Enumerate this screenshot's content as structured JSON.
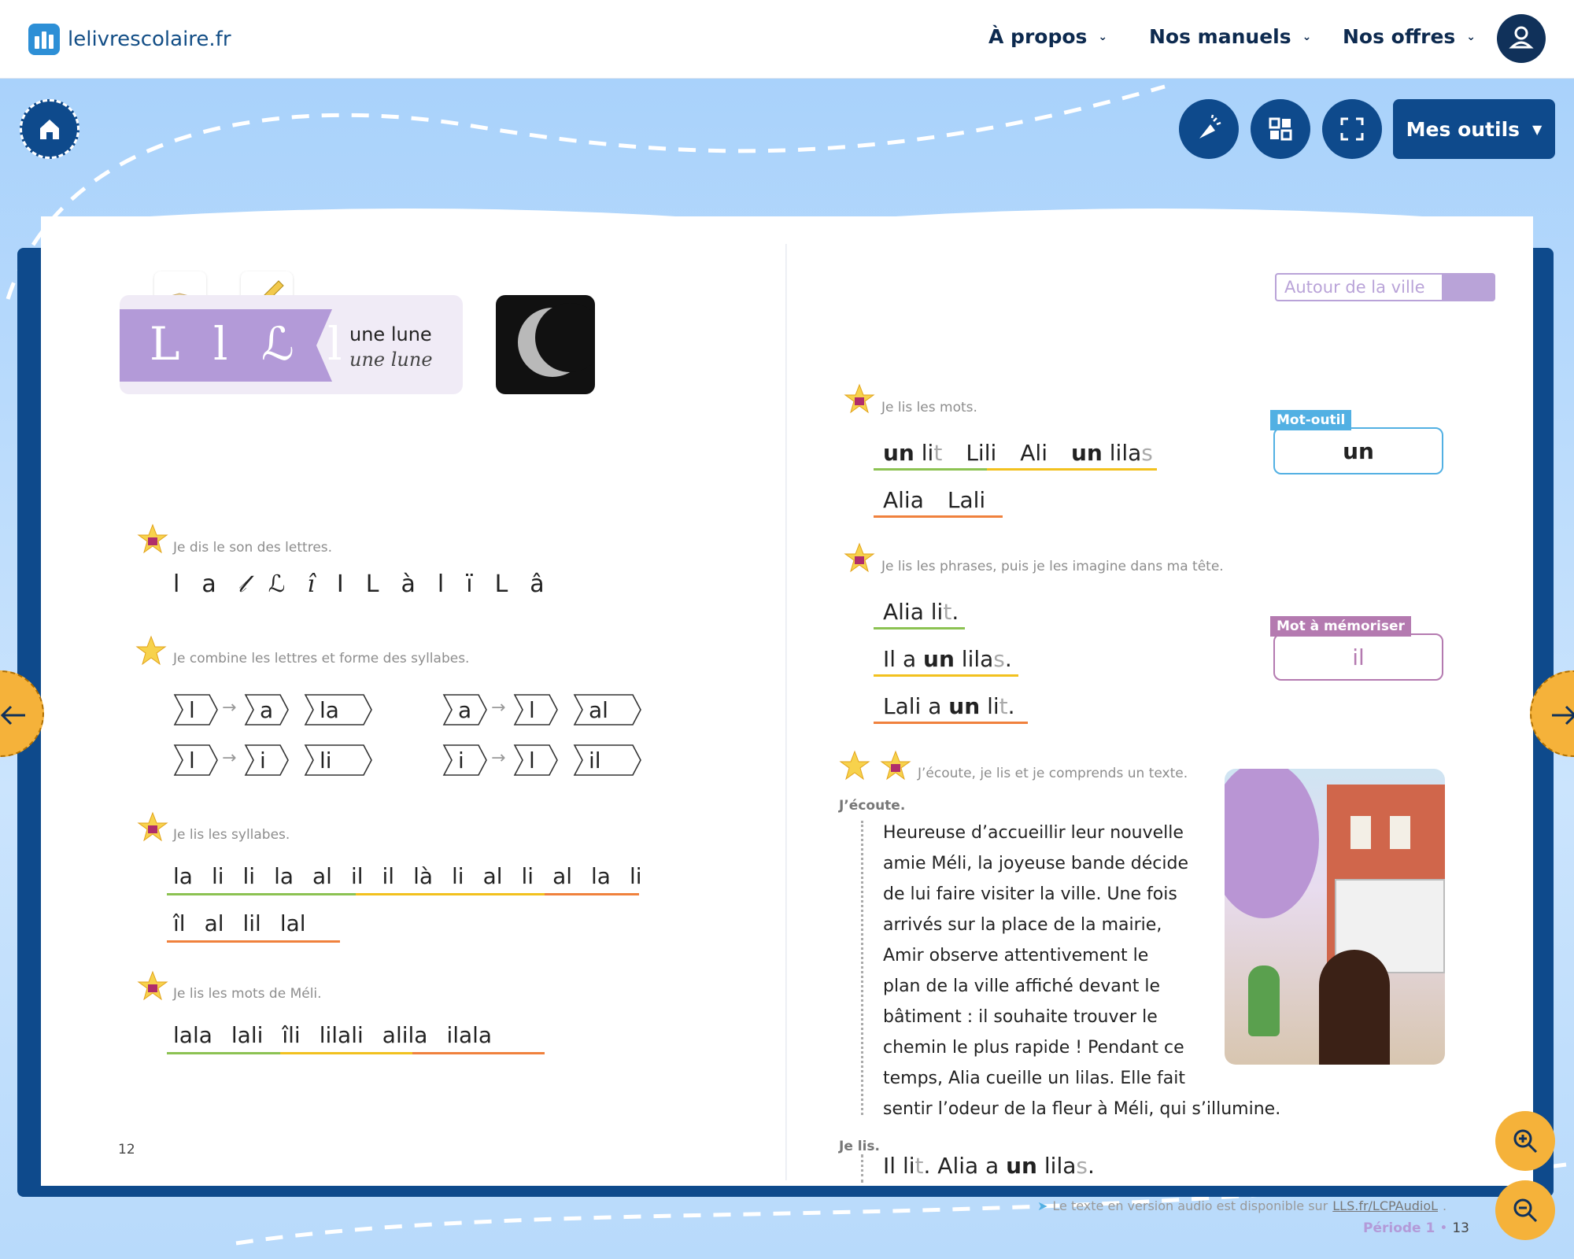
{
  "header": {
    "logo_text": "lelivrescolaire.fr",
    "nav": [
      {
        "label": "À propos"
      },
      {
        "label": "Nos manuels"
      },
      {
        "label": "Nos offres"
      }
    ],
    "account_icon": "user-icon"
  },
  "toolbar": {
    "home_icon": "home-icon",
    "tools_label": "Mes outils",
    "icons": [
      "highlight-icon",
      "grid-icon",
      "fullscreen-icon"
    ]
  },
  "left_page": {
    "letters_title": "L l ℒ l",
    "word_print": "une lune",
    "word_cursive": "une lune",
    "section1_instruction": "Je dis le son des lettres.",
    "section1_letters": [
      "l",
      "a",
      "𝓁",
      "ℒ",
      "î",
      "I",
      "L",
      "à",
      "l",
      "ï",
      "L",
      "â"
    ],
    "section2_instruction": "Je combine les lettres et forme des syllabes.",
    "combos": [
      {
        "a": "l",
        "b": "a",
        "r": "la"
      },
      {
        "a": "a",
        "b": "l",
        "r": "al"
      },
      {
        "a": "l",
        "b": "i",
        "r": "li"
      },
      {
        "a": "i",
        "b": "l",
        "r": "il"
      }
    ],
    "section3_instruction": "Je lis les syllabes.",
    "syllables_line1": [
      "la",
      "li",
      "li",
      "la",
      "al",
      "il",
      "il",
      "là",
      "li",
      "al",
      "li",
      "al",
      "la",
      "li"
    ],
    "syllables_line2": [
      "îl",
      "al",
      "lil",
      "lal"
    ],
    "section4_instruction": "Je lis les mots de Méli.",
    "meli_words": [
      "lala",
      "lali",
      "îli",
      "lilali",
      "alila",
      "ilala"
    ],
    "page_number": "12"
  },
  "right_page": {
    "theme_tag": "Autour de la ville",
    "words_instruction": "Je lis les mots.",
    "words_line1": [
      {
        "bold": "un",
        "rest": "li",
        "silent": "t"
      },
      {
        "bold": "",
        "rest": "Lili",
        "silent": ""
      },
      {
        "bold": "",
        "rest": "Ali",
        "silent": ""
      },
      {
        "bold": "un",
        "rest": "lila",
        "silent": "s"
      }
    ],
    "words_line2": [
      "Alia",
      "Lali"
    ],
    "mot_outil_label": "Mot-outil",
    "mot_outil_value": "un",
    "sentences_instruction": "Je lis les phrases, puis je les imagine dans ma tête.",
    "sentence1_a": "Alia li",
    "sentence1_silent": "t",
    "sentence1_end": ".",
    "sentence2_a": "Il a",
    "sentence2_bold": "un",
    "sentence2_b": "lila",
    "sentence2_silent": "s",
    "sentence2_end": ".",
    "sentence3_a": "Lali a",
    "sentence3_bold": "un",
    "sentence3_b": "li",
    "sentence3_silent": "t",
    "sentence3_end": ".",
    "memo_label": "Mot à mémoriser",
    "memo_value": "il",
    "listen_instruction": "J’écoute, je lis et je comprends un texte.",
    "ecoute_label": "J’écoute.",
    "story_lines": [
      "Heureuse d’accueillir leur nouvelle",
      "amie Méli, la joyeuse bande décide",
      "de lui faire visiter la ville. Une fois",
      "arrivés sur la place de la mairie,",
      "Amir observe attentivement le",
      "plan de la ville affiché devant le",
      "bâtiment : il souhaite trouver le",
      "chemin le plus rapide ! Pendant ce",
      "temps, Alia cueille un lilas. Elle fait",
      "sentir l’odeur de la fleur à Méli, qui s’illumine."
    ],
    "jelis_label": "Je lis.",
    "final_a": "Il li",
    "final_silent1": "t",
    "final_b": ". Alia a",
    "final_bold": "un",
    "final_c": "lila",
    "final_silent2": "s",
    "final_end": ".",
    "audio_prefix": "Le texte en version audio est disponible sur",
    "audio_link": "LLS.fr/LCPAudioL",
    "audio_suffix": ".",
    "period_label": "Période 1",
    "page_sep": "•",
    "page_number": "13"
  },
  "colors": {
    "navy": "#0e4a8c",
    "accent_orange": "#f5b23a",
    "purple": "#b9a3d8",
    "teal_blue": "#52b0e3",
    "pink_purple": "#b47ab0"
  }
}
